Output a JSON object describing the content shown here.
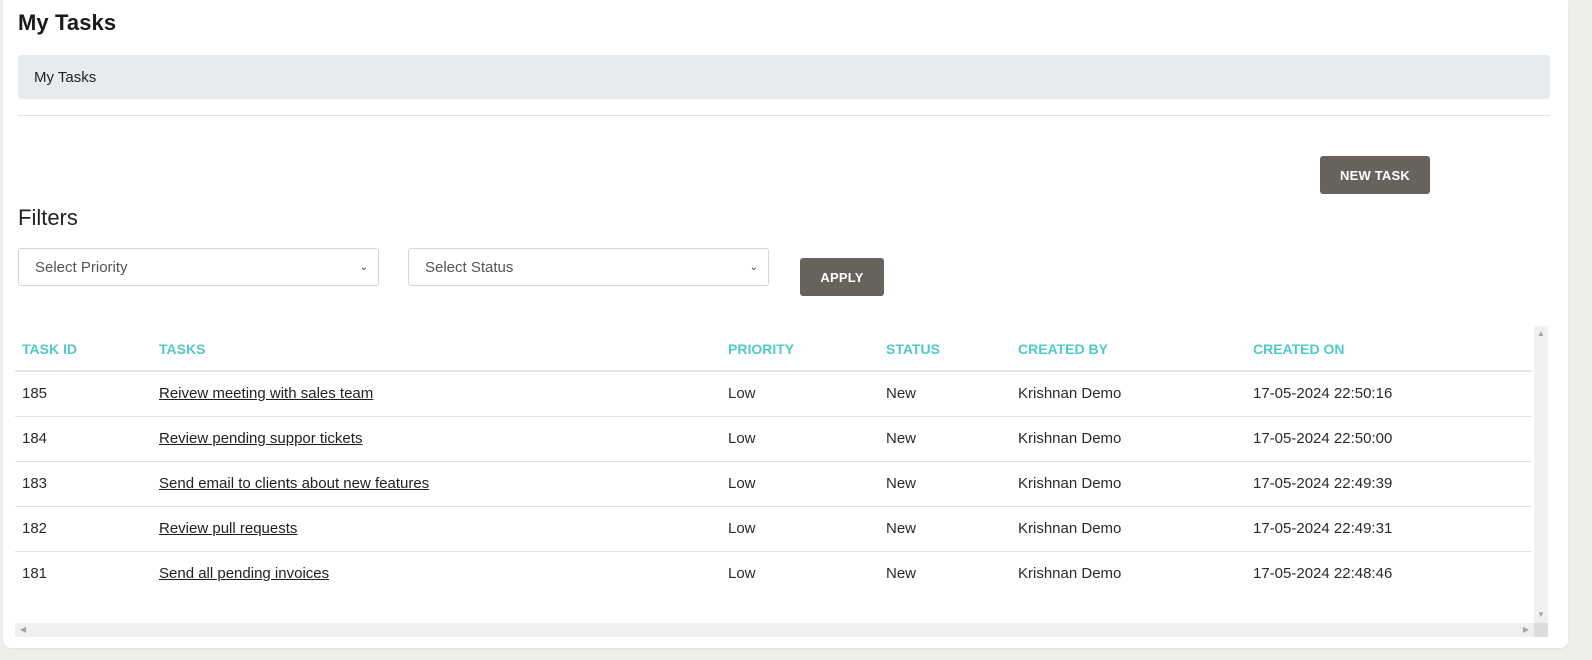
{
  "page": {
    "title": "My Tasks"
  },
  "breadcrumb": {
    "items": [
      "My Tasks"
    ]
  },
  "toolbar": {
    "new_task_label": "NEW TASK"
  },
  "filters": {
    "title": "Filters",
    "priority_select": {
      "selected": "Select Priority"
    },
    "status_select": {
      "selected": "Select Status"
    },
    "apply_label": "APPLY"
  },
  "colors": {
    "accent_header": "#4fc9c9",
    "button_bg": "#67625b",
    "breadcrumb_bg": "#e8ebee"
  },
  "table": {
    "columns": [
      "TASK ID",
      "TASKS",
      "PRIORITY",
      "STATUS",
      "CREATED BY",
      "CREATED ON"
    ],
    "rows": [
      {
        "id": "185",
        "task": "Reivew meeting with sales team",
        "priority": "Low",
        "status": "New",
        "created_by": "Krishnan Demo",
        "created_on": "17-05-2024 22:50:16"
      },
      {
        "id": "184",
        "task": "Review pending suppor tickets",
        "priority": "Low",
        "status": "New",
        "created_by": "Krishnan Demo",
        "created_on": "17-05-2024 22:50:00"
      },
      {
        "id": "183",
        "task": "Send email to clients about new features",
        "priority": "Low",
        "status": "New",
        "created_by": "Krishnan Demo",
        "created_on": "17-05-2024 22:49:39"
      },
      {
        "id": "182",
        "task": "Review pull requests",
        "priority": "Low",
        "status": "New",
        "created_by": "Krishnan Demo",
        "created_on": "17-05-2024 22:49:31"
      },
      {
        "id": "181",
        "task": "Send all pending invoices",
        "priority": "Low",
        "status": "New",
        "created_by": "Krishnan Demo",
        "created_on": "17-05-2024 22:48:46"
      }
    ]
  }
}
